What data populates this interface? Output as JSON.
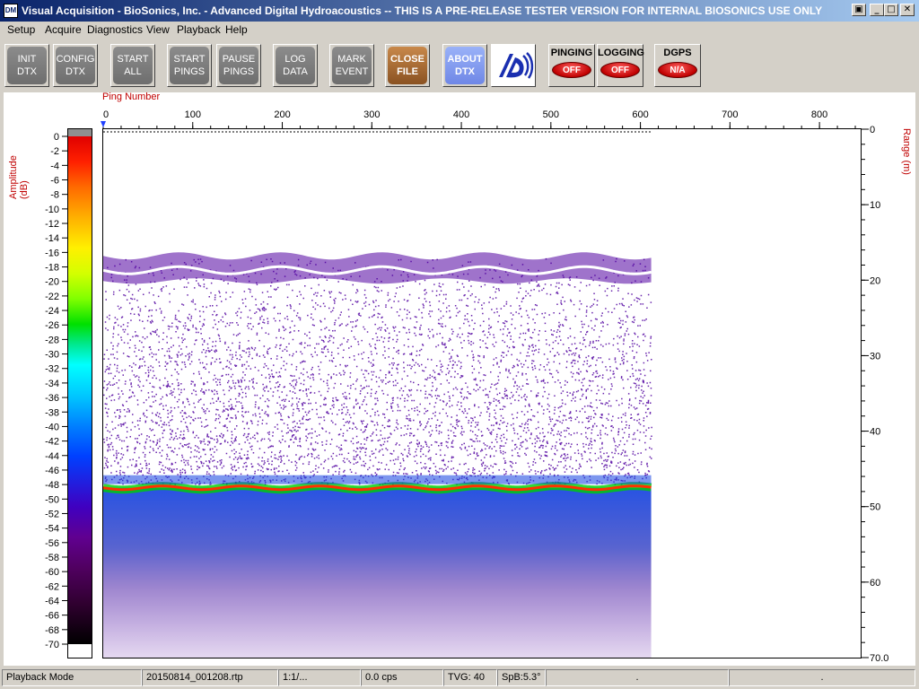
{
  "window": {
    "title": "Visual Acquisition  -  BioSonics, Inc.  -  Advanced Digital Hydroacoustics  -- THIS IS A PRE-RELEASE TESTER VERSION FOR INTERNAL BIOSONICS USE ONLY",
    "icon_text": "DM",
    "restore_glyph": "▣",
    "minimize_glyph": "_",
    "maximize_glyph": "□",
    "close_glyph": "✕"
  },
  "menu": [
    "Setup",
    "Acquire",
    "Diagnostics",
    "View",
    "Playback",
    "Help"
  ],
  "toolbar": {
    "init": [
      "INIT",
      "DTX"
    ],
    "config": [
      "CONFIG",
      "DTX"
    ],
    "start_all": [
      "START",
      "ALL"
    ],
    "start_pings": [
      "START",
      "PINGS"
    ],
    "pause_pings": [
      "PAUSE",
      "PINGS"
    ],
    "log_data": [
      "LOG",
      "DATA"
    ],
    "mark_event": [
      "MARK",
      "EVENT"
    ],
    "close_file": [
      "CLOSE",
      "FILE"
    ],
    "about": [
      "ABOUT",
      "DTX"
    ],
    "pinging": {
      "label": "PINGING",
      "state": "OFF"
    },
    "logging": {
      "label": "LOGGING",
      "state": "OFF"
    },
    "dgps": {
      "label": "DGPS",
      "state": "N/A"
    }
  },
  "echogram": {
    "ping_label": "Ping Number",
    "amplitude_label": "Amplitude (dB)",
    "range_label": "Range (m)",
    "ping_ticks": [
      "0",
      "100",
      "200",
      "300",
      "400",
      "500",
      "600",
      "700",
      "800"
    ],
    "range_ticks": [
      "0",
      "10",
      "20",
      "30",
      "40",
      "50",
      "60",
      "70.0"
    ],
    "amp_ticks": [
      "0",
      "-2",
      "-4",
      "-6",
      "-8",
      "-10",
      "-12",
      "-14",
      "-16",
      "-18",
      "-20",
      "-22",
      "-24",
      "-26",
      "-28",
      "-30",
      "-32",
      "-34",
      "-36",
      "-38",
      "-40",
      "-42",
      "-44",
      "-46",
      "-48",
      "-50",
      "-52",
      "-54",
      "-56",
      "-58",
      "-60",
      "-62",
      "-64",
      "-66",
      "-68",
      "-70"
    ],
    "ping_max": 846,
    "range_max": 70,
    "last_ping": 612,
    "surface_layer_depth_m": 17.5,
    "bottom_depth_m": 47.5,
    "colors": {
      "accent_label": "#c00000",
      "bottom_line": "#ff3000",
      "bottom_core": "#00d000",
      "scatter": "#5000a0",
      "deep": "#1040e0"
    }
  },
  "statusbar": [
    "Playback Mode",
    "20150814_001208.rtp",
    "1:1/...",
    "0.0 cps",
    "TVG: 40",
    "SpB:5.3°",
    ".",
    "."
  ]
}
